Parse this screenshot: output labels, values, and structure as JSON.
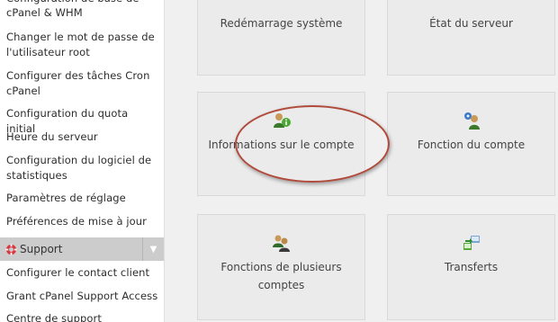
{
  "sidebar": {
    "items": [
      {
        "label": "Configuration de base de cPanel & WHM"
      },
      {
        "label": "Changer le mot de passe de l'utilisateur root"
      },
      {
        "label": "Configurer des tâches Cron cPanel"
      },
      {
        "label": "Configuration du quota initial"
      },
      {
        "label": "Heure du serveur"
      },
      {
        "label": "Configuration du logiciel de statistiques"
      },
      {
        "label": "Paramètres de réglage"
      },
      {
        "label": "Préférences de mise à jour"
      }
    ],
    "support": {
      "label": "Support",
      "icon": "lifebuoy-icon",
      "items": [
        {
          "label": "Configurer le contact client"
        },
        {
          "label": "Grant cPanel Support Access"
        },
        {
          "label": "Centre de support"
        }
      ]
    }
  },
  "cards": [
    {
      "label": "Redémarrage système"
    },
    {
      "label": "État du serveur"
    },
    {
      "label": "Informations sur le compte",
      "icon": "user-info-icon"
    },
    {
      "label": "Fonction du compte",
      "icon": "user-gear-icon"
    },
    {
      "label": "Fonctions de plusieurs comptes",
      "icon": "multiple-users-icon"
    },
    {
      "label": "Transferts",
      "icon": "transfer-icon"
    }
  ],
  "colors": {
    "background": "#f0f0f0",
    "card": "#ebebeb",
    "highlight": "#b04a3a",
    "support_header": "#cccccc"
  }
}
